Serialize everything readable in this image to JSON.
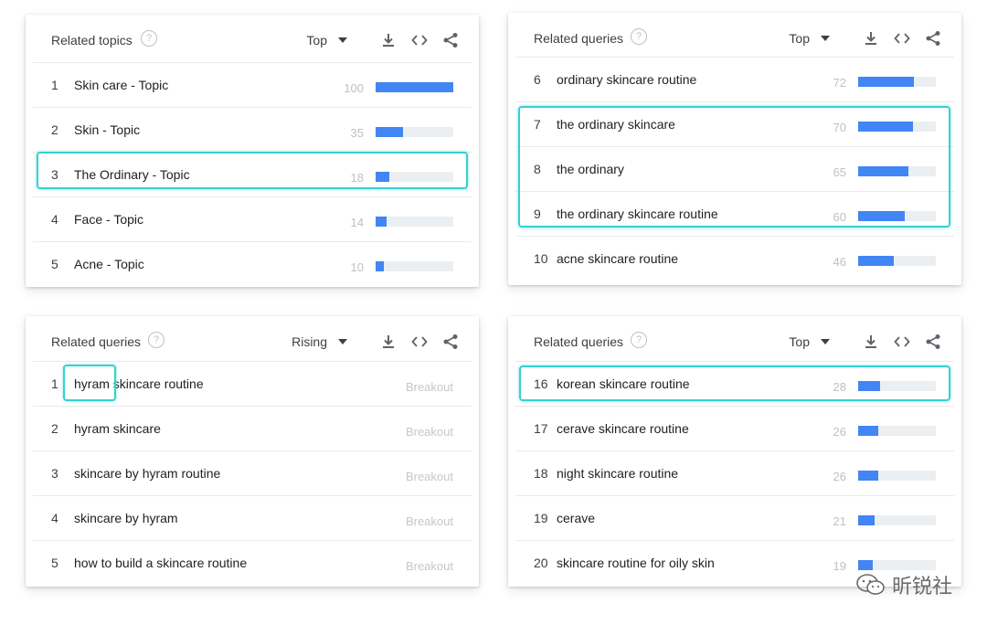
{
  "cards": [
    {
      "title": "Related topics",
      "filter": "Top",
      "rows": [
        {
          "rank": "1",
          "label": "Skin care - Topic",
          "value": 100
        },
        {
          "rank": "2",
          "label": "Skin - Topic",
          "value": 35
        },
        {
          "rank": "3",
          "label": "The Ordinary - Topic",
          "value": 18
        },
        {
          "rank": "4",
          "label": "Face - Topic",
          "value": 14
        },
        {
          "rank": "5",
          "label": "Acne - Topic",
          "value": 10
        }
      ]
    },
    {
      "title": "Related queries",
      "filter": "Top",
      "rows": [
        {
          "rank": "6",
          "label": "ordinary skincare routine",
          "value": 72
        },
        {
          "rank": "7",
          "label": "the ordinary skincare",
          "value": 70
        },
        {
          "rank": "8",
          "label": "the ordinary",
          "value": 65
        },
        {
          "rank": "9",
          "label": "the ordinary skincare routine",
          "value": 60
        },
        {
          "rank": "10",
          "label": "acne skincare routine",
          "value": 46
        }
      ]
    },
    {
      "title": "Related queries",
      "filter": "Rising",
      "rows": [
        {
          "rank": "1",
          "label": "hyram skincare routine",
          "breakout": "Breakout"
        },
        {
          "rank": "2",
          "label": "hyram skincare",
          "breakout": "Breakout"
        },
        {
          "rank": "3",
          "label": "skincare by hyram routine",
          "breakout": "Breakout"
        },
        {
          "rank": "4",
          "label": "skincare by hyram",
          "breakout": "Breakout"
        },
        {
          "rank": "5",
          "label": "how to build a skincare routine",
          "breakout": "Breakout"
        }
      ]
    },
    {
      "title": "Related queries",
      "filter": "Top",
      "rows": [
        {
          "rank": "16",
          "label": "korean skincare routine",
          "value": 28
        },
        {
          "rank": "17",
          "label": "cerave skincare routine",
          "value": 26
        },
        {
          "rank": "18",
          "label": "night skincare routine",
          "value": 26
        },
        {
          "rank": "19",
          "label": "cerave",
          "value": 21
        },
        {
          "rank": "20",
          "label": "skincare routine for oily skin",
          "value": 19
        }
      ]
    }
  ],
  "icons": {
    "help": "?",
    "download": "download-icon",
    "embed": "embed-icon",
    "share": "share-icon"
  },
  "colors": {
    "bar": "#4285f4",
    "track": "#eceff1",
    "highlight": "#34d1d3"
  },
  "watermark": "昕锐社"
}
